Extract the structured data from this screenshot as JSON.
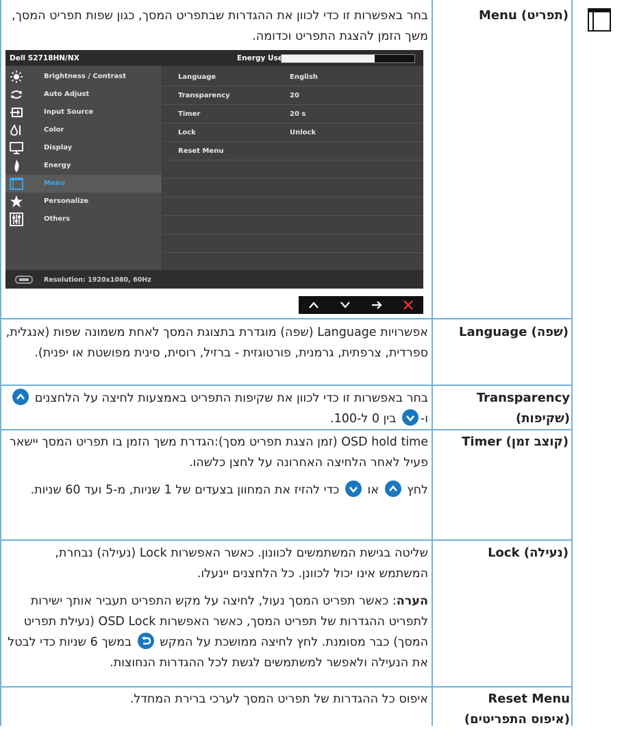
{
  "osd": {
    "model": "Dell S2718HN/NX",
    "energy_label": "Energy Use",
    "menu_items": [
      {
        "label": "Brightness / Contrast",
        "icon": "brightness-icon"
      },
      {
        "label": "Auto Adjust",
        "icon": "auto-adjust-icon"
      },
      {
        "label": "Input Source",
        "icon": "input-source-icon"
      },
      {
        "label": "Color",
        "icon": "color-icon"
      },
      {
        "label": "Display",
        "icon": "display-icon"
      },
      {
        "label": "Energy",
        "icon": "energy-icon"
      },
      {
        "label": "Menu",
        "icon": "menu-icon"
      },
      {
        "label": "Personalize",
        "icon": "star-icon"
      },
      {
        "label": "Others",
        "icon": "others-icon"
      }
    ],
    "settings": [
      {
        "key": "Language",
        "value": "English"
      },
      {
        "key": "Transparency",
        "value": "20"
      },
      {
        "key": "Timer",
        "value": "20 s"
      },
      {
        "key": "Lock",
        "value": "Unlock"
      },
      {
        "key": "Reset Menu",
        "value": ""
      }
    ],
    "resolution": "Resolution: 1920x1080, 60Hz",
    "nav_buttons": [
      "up-arrow-icon",
      "down-arrow-icon",
      "right-arrow-icon",
      "close-icon"
    ]
  },
  "rows": {
    "menu": {
      "label": "Menu (תפריט)",
      "desc": "בחר באפשרות זו כדי לכוון את ההגדרות שבתפריט המסך, כגון שפות תפריט המסך, משך הזמן להצגת התפריט וכדומה."
    },
    "language": {
      "label": "Language (שפה)",
      "desc": "אפשרויות Language (שפה) מוגדרת בתצוגת המסך לאחת משמונה שפות (אנגלית, ספרדית, צרפתית, גרמנית, פורטוגזית - ברזיל, רוסית, סינית מפושטת או יפנית)."
    },
    "transparency": {
      "label": "Transparency (שקיפות)",
      "desc_a": "בחר באפשרות זו כדי לכוון את שקיפות התפריט באמצעות לחיצה על הלחצנים",
      "desc_b": "ו-",
      "desc_c": "בין 0 ל-100."
    },
    "timer": {
      "label": "Timer (קוצב זמן)",
      "desc1": "OSD hold time (זמן הצגת תפריט מסך):הגדרת משך הזמן בו תפריט המסך יישאר פעיל לאחר הלחיצה האחרונה על לחצן כלשהו.",
      "desc2_a": "לחץ",
      "desc2_b": "או",
      "desc2_c": "כדי להזיז את המחוון בצעדים של 1 שניות, מ-5 ועד 60 שניות."
    },
    "lock": {
      "label": "Lock (נעילה)",
      "desc1": "שליטה בגישת המשתמשים לכוונון. כאשר האפשרות Lock (נעילה) נבחרת, המשתמש אינו יכול לכוונן. כל הלחצנים יינעלו.",
      "note_bold": "הערה",
      "note_a": ": כאשר תפריט המסך נעול, לחיצה על מקש התפריט תעביר אותך ישירות לתפריט ההגדרות של תפריט המסך, כאשר האפשרות OSD Lock (נעילת תפריט המסך) כבר מסומנת. לחץ לחיצה ממושכת על המקש",
      "note_b": "במשך 6 שניות כדי לבטל את הנעילה ולאפשר למשתמשים לגשת לכל ההגדרות הנחוצות."
    },
    "reset": {
      "label": "Reset Menu (איפוס התפריטים)",
      "desc": "איפוס כל ההגדרות של תפריט המסך לערכי ברירת המחדל."
    }
  },
  "colors": {
    "rule": "#6fb3da",
    "button_blue": "#1877be",
    "osd_highlight": "#3aa8f0",
    "close_red": "#e8312f"
  }
}
